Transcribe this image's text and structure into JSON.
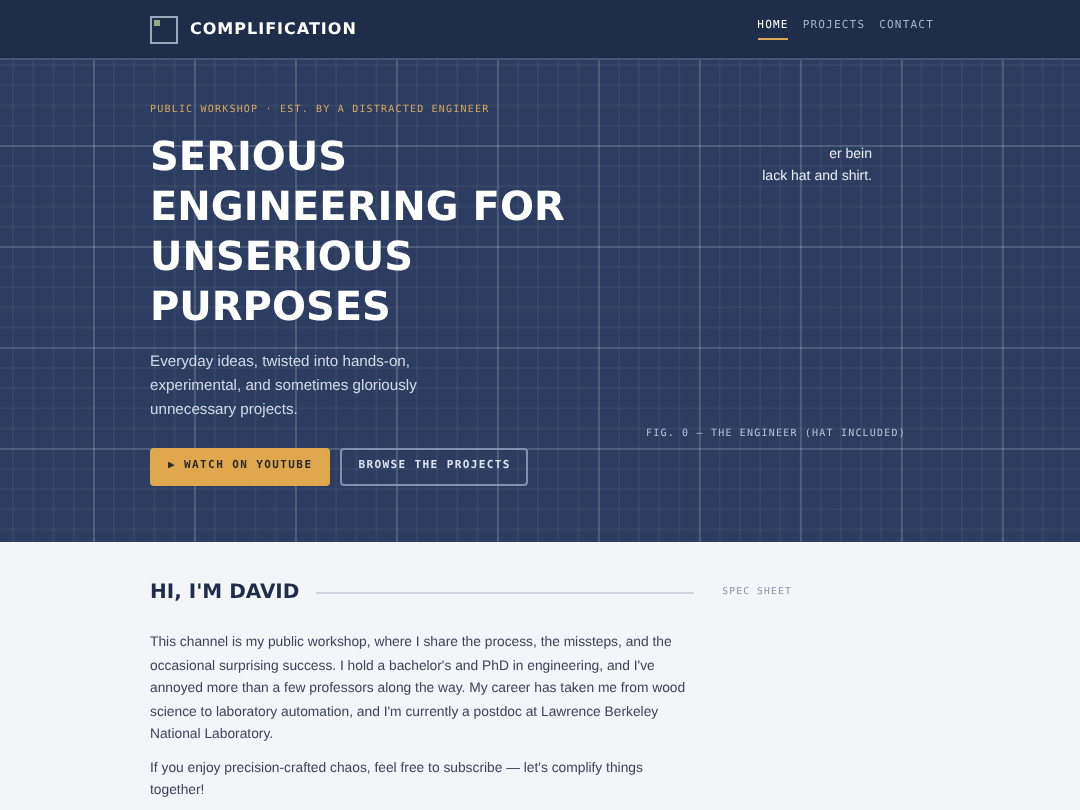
{
  "header": {
    "brand": "COMPLIFICATION",
    "nav": [
      {
        "label": "HOME",
        "selected": true
      },
      {
        "label": "PROJECTS",
        "selected": false
      },
      {
        "label": "CONTACT",
        "selected": false
      }
    ]
  },
  "hero": {
    "eyebrow": "PUBLIC WORKSHOP · EST. BY A DISTRACTED ENGINEER",
    "title_lines": [
      "SERIOUS",
      "ENGINEERING FOR",
      "UNSERIOUS",
      "PURPOSES"
    ],
    "tagline": "Everyday ideas, twisted into hands-on, experimental, and sometimes gloriously unnecessary projects.",
    "buttons": [
      {
        "label": "▶ WATCH ON YOUTUBE",
        "kind": "primary"
      },
      {
        "label": "BROWSE THE PROJECTS",
        "kind": "outline"
      }
    ],
    "image_alt_lines": [
      "er bein",
      "lack hat and shirt."
    ],
    "caption": "FIG. 0 — THE ENGINEER (HAT INCLUDED)"
  },
  "about": {
    "heading": "HI, I'M DAVID",
    "aside": "SPEC SHEET",
    "paragraphs": [
      "This channel is my public workshop, where I share the process, the missteps, and the occasional surprising success. I hold a bachelor's and PhD in engineering, and I've annoyed more than a few professors along the way. My career has taken me from wood science to laboratory automation, and I'm currently a postdoc at Lawrence Berkeley National Laboratory.",
      "If you enjoy precision-crafted chaos, feel free to subscribe — let's complify things together!"
    ]
  }
}
